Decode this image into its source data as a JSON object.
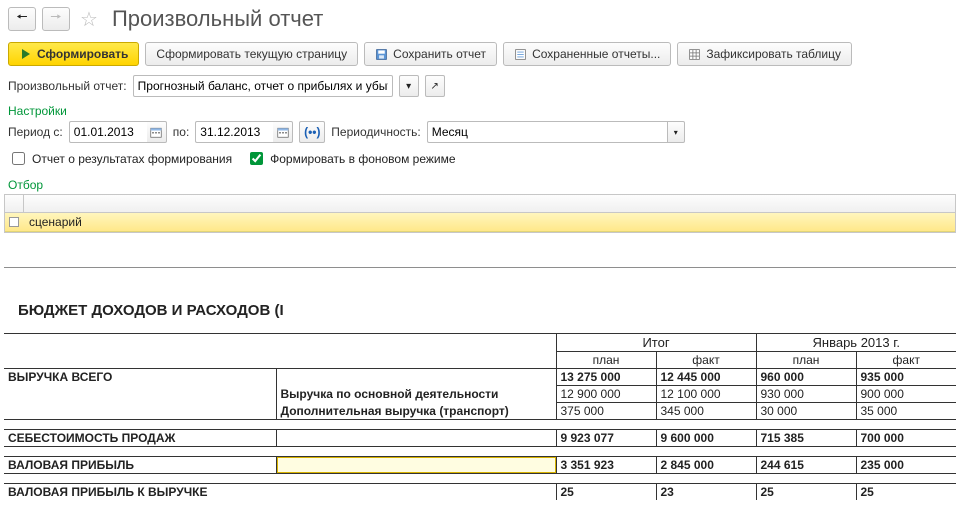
{
  "header": {
    "title": "Произвольный отчет"
  },
  "toolbar": {
    "form": "Сформировать",
    "form_page": "Сформировать текущую страницу",
    "save": "Сохранить отчет",
    "saved": "Сохраненные отчеты...",
    "fix_table": "Зафиксировать таблицу"
  },
  "report_select": {
    "label": "Произвольный отчет:",
    "value": "Прогнозный баланс, отчет о прибылях и убытках"
  },
  "settings": {
    "title": "Настройки",
    "period_from_label": "Период с:",
    "period_from": "01.01.2013",
    "period_to_label": "по:",
    "period_to": "31.12.2013",
    "periodicity_label": "Периодичность:",
    "periodicity_value": "Месяц",
    "chk_results": "Отчет о результатах формирования",
    "chk_background": "Формировать в фоновом режиме"
  },
  "otbor": {
    "title": "Отбор",
    "row1": "сценарий"
  },
  "report": {
    "title": "БЮДЖЕТ ДОХОДОВ И РАСХОДОВ (I",
    "group_total": "Итог",
    "group_jan": "Январь 2013 г.",
    "col_plan": "план",
    "col_fact": "факт",
    "rows": {
      "revenue_total": "ВЫРУЧКА ВСЕГО",
      "revenue_main": "Выручка по основной деятельности",
      "revenue_extra": "Дополнительная выручка (транспорт)",
      "cogs": "СЕБЕСТОИМОСТЬ ПРОДАЖ",
      "gross": "ВАЛОВАЯ ПРИБЫЛЬ",
      "gross_to_rev": "ВАЛОВАЯ ПРИБЫЛЬ К ВЫРУЧКЕ"
    },
    "data": {
      "revenue_total": {
        "t_plan": "13 275 000",
        "t_fact": "12 445 000",
        "j_plan": "960 000",
        "j_fact": "935 000"
      },
      "revenue_main": {
        "t_plan": "12 900 000",
        "t_fact": "12 100 000",
        "j_plan": "930 000",
        "j_fact": "900 000"
      },
      "revenue_extra": {
        "t_plan": "375 000",
        "t_fact": "345 000",
        "j_plan": "30 000",
        "j_fact": "35 000"
      },
      "cogs": {
        "t_plan": "9 923 077",
        "t_fact": "9 600 000",
        "j_plan": "715 385",
        "j_fact": "700 000"
      },
      "gross": {
        "t_plan": "3 351 923",
        "t_fact": "2 845 000",
        "j_plan": "244 615",
        "j_fact": "235 000"
      },
      "gross_to_rev": {
        "t_plan": "25",
        "t_fact": "23",
        "j_plan": "25",
        "j_fact": "25"
      }
    }
  }
}
